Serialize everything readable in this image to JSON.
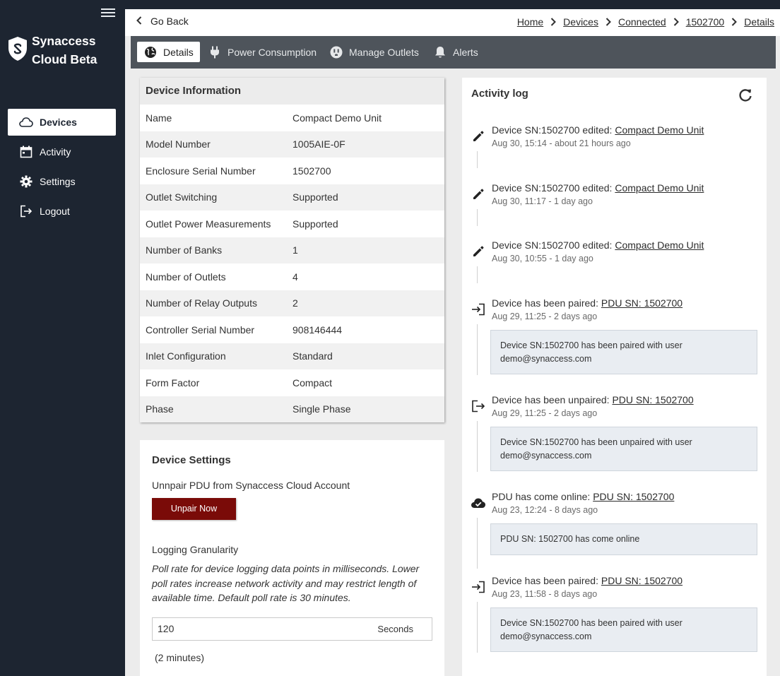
{
  "app": {
    "name_line1": "Synaccess",
    "name_line2": "Cloud Beta"
  },
  "sidebar": {
    "items": [
      {
        "label": "Devices",
        "icon": "cloud-icon",
        "active": true
      },
      {
        "label": "Activity",
        "icon": "calendar-icon",
        "active": false
      },
      {
        "label": "Settings",
        "icon": "gear-icon",
        "active": false
      },
      {
        "label": "Logout",
        "icon": "logout-icon",
        "active": false
      }
    ]
  },
  "subbar": {
    "go_back": "Go Back",
    "breadcrumbs": [
      "Home",
      "Devices",
      "Connected",
      "1502700",
      "Details"
    ]
  },
  "tabs": [
    {
      "label": "Details",
      "icon": "globe-icon",
      "active": true
    },
    {
      "label": "Power Consumption",
      "icon": "plug-icon",
      "active": false
    },
    {
      "label": "Manage Outlets",
      "icon": "outlet-icon",
      "active": false
    },
    {
      "label": "Alerts",
      "icon": "bell-icon",
      "active": false
    }
  ],
  "device_info": {
    "title": "Device Information",
    "rows": [
      {
        "key": "Name",
        "value": "Compact Demo Unit"
      },
      {
        "key": "Model Number",
        "value": "1005AIE-0F"
      },
      {
        "key": "Enclosure Serial Number",
        "value": "1502700"
      },
      {
        "key": "Outlet Switching",
        "value": "Supported"
      },
      {
        "key": "Outlet Power Measurements",
        "value": "Supported"
      },
      {
        "key": "Number of Banks",
        "value": "1"
      },
      {
        "key": "Number of Outlets",
        "value": "4"
      },
      {
        "key": "Number of Relay Outputs",
        "value": "2"
      },
      {
        "key": "Controller Serial Number",
        "value": "908146444"
      },
      {
        "key": "Inlet Configuration",
        "value": "Standard"
      },
      {
        "key": "Form Factor",
        "value": "Compact"
      },
      {
        "key": "Phase",
        "value": "Single Phase"
      }
    ]
  },
  "device_settings": {
    "title": "Device Settings",
    "unpair_label": "Unnpair PDU from Synaccess Cloud Account",
    "unpair_button": "Unpair Now",
    "logging_label": "Logging Granularity",
    "logging_desc": "Poll rate for device logging data points in milliseconds. Lower poll rates increase network activity and may restrict length of available time. Default poll rate is 30 minutes.",
    "poll_value": "120",
    "poll_unit": "Seconds",
    "poll_minutes": "(2 minutes)"
  },
  "activity": {
    "title": "Activity log",
    "entries": [
      {
        "icon": "pencil-icon",
        "text": "Device SN:1502700 edited:",
        "link": "Compact Demo Unit",
        "time": "Aug 30, 15:14 - about 21 hours ago",
        "message": ""
      },
      {
        "icon": "pencil-icon",
        "text": "Device SN:1502700 edited:",
        "link": "Compact Demo Unit",
        "time": "Aug 30, 11:17 - 1 day ago",
        "message": ""
      },
      {
        "icon": "pencil-icon",
        "text": "Device SN:1502700 edited:",
        "link": "Compact Demo Unit",
        "time": "Aug 30, 10:55 - 1 day ago",
        "message": ""
      },
      {
        "icon": "login-icon",
        "text": "Device has been paired:",
        "link": "PDU SN: 1502700",
        "time": "Aug 29, 11:25 - 2 days ago",
        "message": "Device SN:1502700 has been paired with user demo@synaccess.com"
      },
      {
        "icon": "logout-icon",
        "text": "Device has been unpaired:",
        "link": "PDU SN: 1502700",
        "time": "Aug 29, 11:25 - 2 days ago",
        "message": "Device SN:1502700 has been unpaired with user demo@synaccess.com"
      },
      {
        "icon": "cloud-check-icon",
        "text": "PDU has come online:",
        "link": "PDU SN: 1502700",
        "time": "Aug 23, 12:24 - 8 days ago",
        "message": "PDU SN: 1502700 has come online"
      },
      {
        "icon": "login-icon",
        "text": "Device has been paired:",
        "link": "PDU SN: 1502700",
        "time": "Aug 23, 11:58 - 8 days ago",
        "message": "Device SN:1502700 has been paired with user demo@synaccess.com"
      }
    ]
  },
  "colors": {
    "sidebar_bg": "#1d2531",
    "tabs_bg": "#4e545b",
    "danger_button": "#7a0b08"
  }
}
